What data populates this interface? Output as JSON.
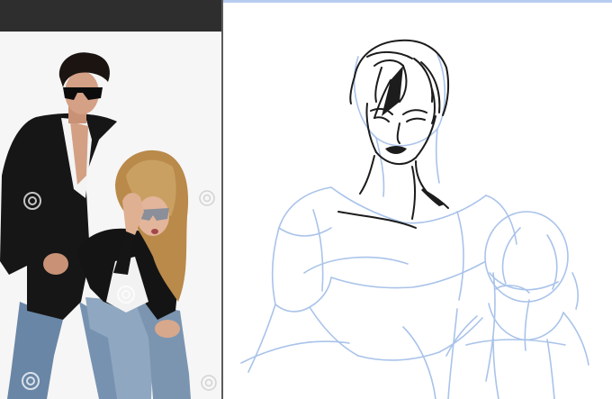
{
  "reference_panel": {
    "image": "reference-photo",
    "watermark_icon": "dreamstime-spiral-icon"
  },
  "drawing_canvas": {
    "content": "sketch"
  },
  "colors": {
    "topbar": "#2e2e2e",
    "divider": "#5b5b5b",
    "canvas_background": "#ffffff",
    "canvas_accent": "#b8ccf0",
    "sketch_blue": "#9fbde8",
    "ink": "#1c1c1c"
  }
}
